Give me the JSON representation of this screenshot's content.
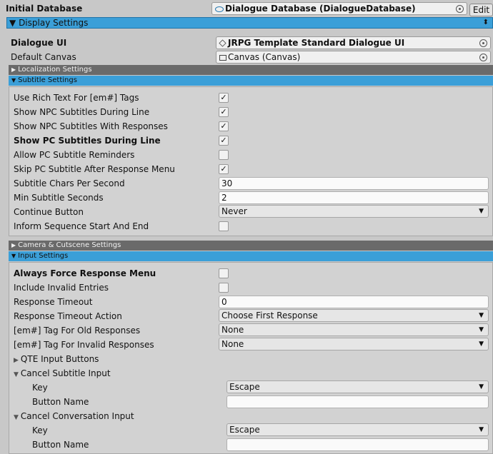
{
  "initial_database": {
    "label": "Initial Database",
    "value": "Dialogue Database (DialogueDatabase)",
    "edit": "Edit"
  },
  "display_settings": {
    "label": "Display Settings",
    "arrow": "▼"
  },
  "dialogue_ui": {
    "label": "Dialogue UI",
    "value": "JRPG Template Standard Dialogue UI"
  },
  "default_canvas": {
    "label": "Default Canvas",
    "value": "Canvas (Canvas)"
  },
  "localization": {
    "label": "Localization Settings"
  },
  "subtitle": {
    "label": "Subtitle Settings",
    "rows": [
      {
        "label": "Use Rich Text For [em#] Tags",
        "checked": "✓"
      },
      {
        "label": "Show NPC Subtitles During Line",
        "checked": "✓"
      },
      {
        "label": "Show NPC Subtitles With Responses",
        "checked": "✓"
      },
      {
        "label": "Show PC Subtitles During Line",
        "checked": "✓"
      },
      {
        "label": "Allow PC Subtitle Reminders",
        "checked": ""
      },
      {
        "label": "Skip PC Subtitle After Response Menu",
        "checked": "✓"
      }
    ],
    "chars_per_second": {
      "label": "Subtitle Chars Per Second",
      "value": "30"
    },
    "min_seconds": {
      "label": "Min Subtitle Seconds",
      "value": "2"
    },
    "continue_button": {
      "label": "Continue Button",
      "value": "Never"
    },
    "inform_sequence": {
      "label": "Inform Sequence Start And End",
      "checked": ""
    }
  },
  "camera": {
    "label": "Camera & Cutscene Settings"
  },
  "input": {
    "label": "Input Settings",
    "always_force": {
      "label": "Always Force Response Menu",
      "checked": ""
    },
    "include_invalid": {
      "label": "Include Invalid Entries",
      "checked": ""
    },
    "timeout": {
      "label": "Response Timeout",
      "value": "0"
    },
    "timeout_action": {
      "label": "Response Timeout Action",
      "value": "Choose First Response"
    },
    "old_responses": {
      "label": "[em#] Tag For Old Responses",
      "value": "None"
    },
    "invalid_responses": {
      "label": "[em#] Tag For Invalid Responses",
      "value": "None"
    },
    "qte": {
      "label": "QTE Input Buttons"
    },
    "cancel_subtitle": {
      "label": "Cancel Subtitle Input",
      "key_label": "Key",
      "key_value": "Escape",
      "button_label": "Button Name",
      "button_value": ""
    },
    "cancel_conversation": {
      "label": "Cancel Conversation Input",
      "key_label": "Key",
      "key_value": "Escape",
      "button_label": "Button Name",
      "button_value": ""
    }
  }
}
